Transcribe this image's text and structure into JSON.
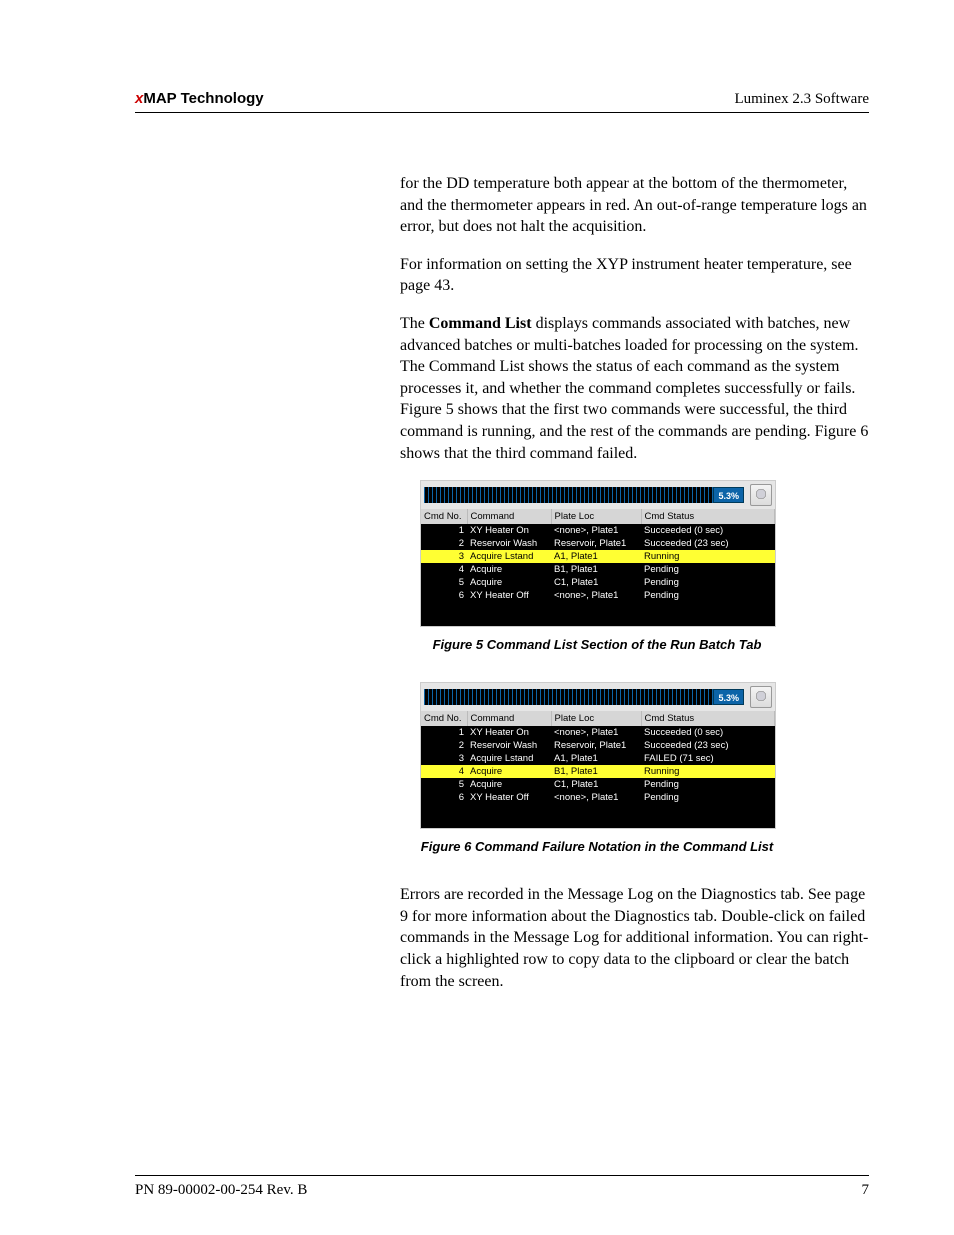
{
  "header": {
    "brand_x": "x",
    "brand_rest": "MAP Technology",
    "right": "Luminex 2.3 Software"
  },
  "paragraphs": {
    "p1": "for the DD temperature both appear at the bottom of the thermometer, and the thermometer appears in red. An out-of-range temperature logs an error, but does not halt the acquisition.",
    "p2": "For information on setting the XYP instrument heater temperature, see page 43.",
    "p3_a": "The ",
    "p3_bold": "Command List",
    "p3_b": " displays commands associated with batches, new advanced batches or multi-batches loaded for processing on the system. The Command List shows the status of each command as the system processes it, and whether the command completes successfully or fails. Figure 5 shows that the first two commands were successful, the third command is running, and the rest of the commands are pending. Figure 6 shows that the third command failed.",
    "p4": "Errors are recorded in the Message Log on the Diagnostics tab. See page 9 for more information about the Diagnostics tab. Double-click on failed commands in the Message Log for additional information. You can right-click a highlighted row to copy data to the clipboard or clear the batch from the screen."
  },
  "figure5": {
    "progress_pct": "5.3%",
    "caption": "Figure 5   Command List Section of the Run Batch Tab",
    "headers": {
      "c1": "Cmd No.",
      "c2": "Command",
      "c3": "Plate Loc",
      "c4": "Cmd Status"
    },
    "rows": [
      {
        "no": "1",
        "cmd": "XY Heater On",
        "loc": "<none>, Plate1",
        "status": "Succeeded (0 sec)",
        "status_cls": "status-success",
        "row_cls": ""
      },
      {
        "no": "2",
        "cmd": "Reservoir Wash",
        "loc": "Reservoir, Plate1",
        "status": "Succeeded (23 sec)",
        "status_cls": "status-success",
        "row_cls": ""
      },
      {
        "no": "3",
        "cmd": "Acquire Lstand",
        "loc": "A1, Plate1",
        "status": "Running",
        "status_cls": "status-running",
        "row_cls": "row-highlight"
      },
      {
        "no": "4",
        "cmd": "Acquire",
        "loc": "B1, Plate1",
        "status": "Pending",
        "status_cls": "status-pending",
        "row_cls": ""
      },
      {
        "no": "5",
        "cmd": "Acquire",
        "loc": "C1, Plate1",
        "status": "Pending",
        "status_cls": "status-pending",
        "row_cls": ""
      },
      {
        "no": "6",
        "cmd": "XY Heater Off",
        "loc": "<none>, Plate1",
        "status": "Pending",
        "status_cls": "status-pending",
        "row_cls": ""
      }
    ]
  },
  "figure6": {
    "progress_pct": "5.3%",
    "caption": "Figure 6   Command Failure Notation in the Command List",
    "headers": {
      "c1": "Cmd No.",
      "c2": "Command",
      "c3": "Plate Loc",
      "c4": "Cmd Status"
    },
    "rows": [
      {
        "no": "1",
        "cmd": "XY Heater On",
        "loc": "<none>, Plate1",
        "status": "Succeeded (0 sec)",
        "status_cls": "status-success",
        "row_cls": ""
      },
      {
        "no": "2",
        "cmd": "Reservoir Wash",
        "loc": "Reservoir, Plate1",
        "status": "Succeeded (23 sec)",
        "status_cls": "status-success",
        "row_cls": ""
      },
      {
        "no": "3",
        "cmd": "Acquire Lstand",
        "loc": "A1, Plate1",
        "status": "FAILED (71 sec)",
        "status_cls": "status-failed",
        "row_cls": ""
      },
      {
        "no": "4",
        "cmd": "Acquire",
        "loc": "B1, Plate1",
        "status": "Running",
        "status_cls": "status-running",
        "row_cls": "row-highlight"
      },
      {
        "no": "5",
        "cmd": "Acquire",
        "loc": "C1, Plate1",
        "status": "Pending",
        "status_cls": "status-pending",
        "row_cls": ""
      },
      {
        "no": "6",
        "cmd": "XY Heater Off",
        "loc": "<none>, Plate1",
        "status": "Pending",
        "status_cls": "status-pending",
        "row_cls": ""
      }
    ]
  },
  "footer": {
    "left": "PN 89-00002-00-254 Rev. B",
    "right": "7"
  }
}
